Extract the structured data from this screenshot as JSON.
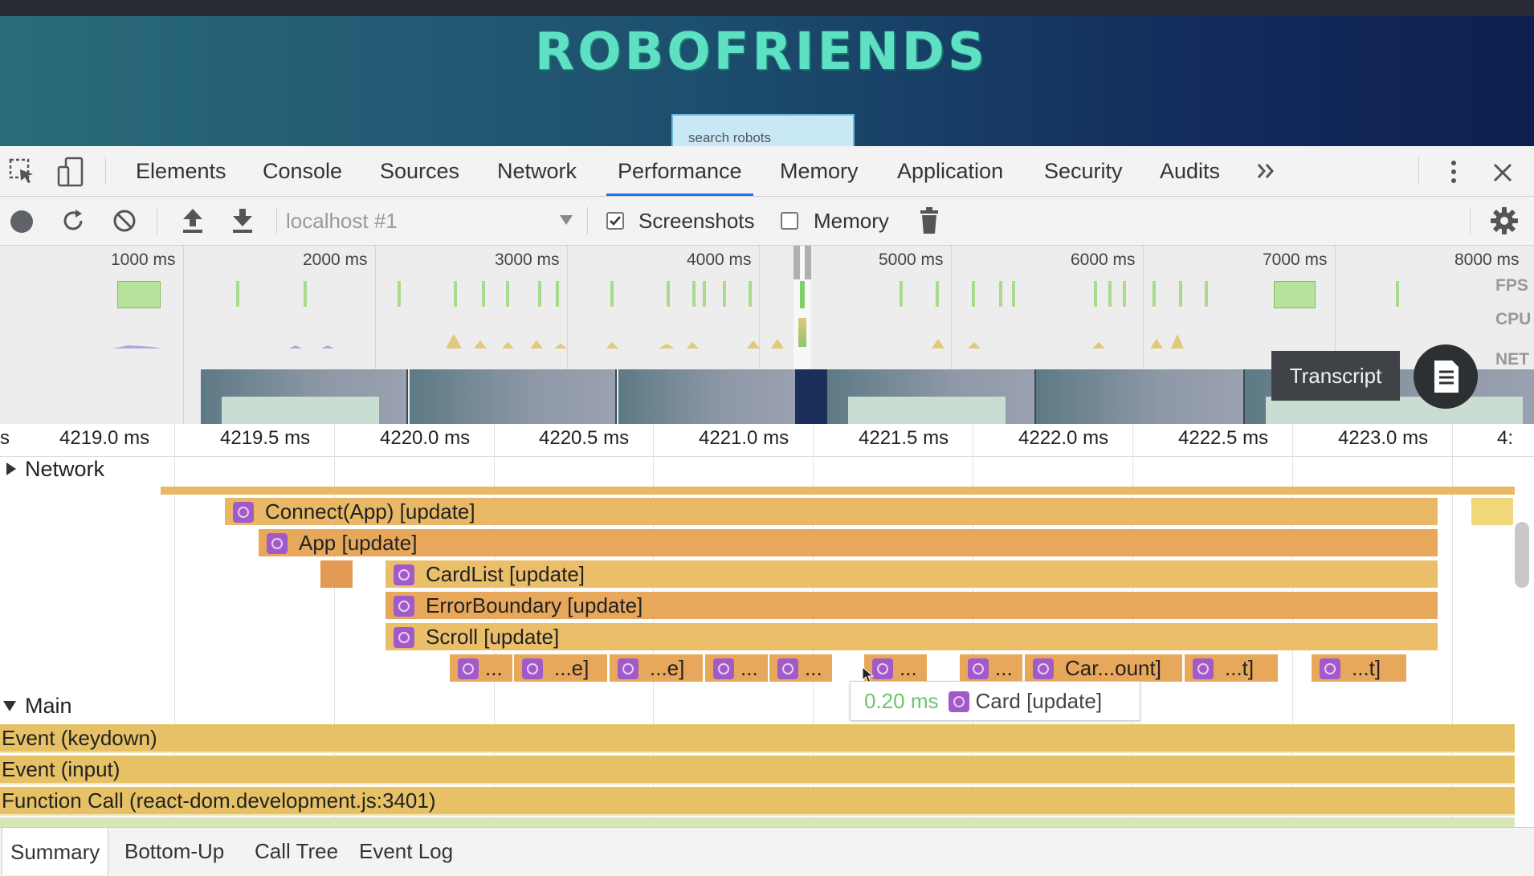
{
  "app": {
    "title": "ROBOFRIENDS",
    "search_placeholder": "search robots"
  },
  "devtools": {
    "tabs": [
      {
        "label": "Elements"
      },
      {
        "label": "Console"
      },
      {
        "label": "Sources"
      },
      {
        "label": "Network"
      },
      {
        "label": "Performance",
        "active": true
      },
      {
        "label": "Memory"
      },
      {
        "label": "Application"
      },
      {
        "label": "Security"
      },
      {
        "label": "Audits"
      }
    ],
    "more_tabs_icon": "double-chevron-right-icon",
    "close_icon": "close-icon"
  },
  "toolbar": {
    "profile_select": "localhost #1",
    "screenshots_label": "Screenshots",
    "screenshots_checked": true,
    "memory_label": "Memory",
    "memory_checked": false
  },
  "overview": {
    "ticks": [
      "1000 ms",
      "2000 ms",
      "3000 ms",
      "4000 ms",
      "5000 ms",
      "6000 ms",
      "7000 ms",
      "8000 ms"
    ],
    "track_labels": {
      "fps": "FPS",
      "cpu": "CPU",
      "net": "NET"
    }
  },
  "transcript": {
    "label": "Transcript",
    "icon": "document-icon"
  },
  "flame": {
    "ruler_ticks": [
      "4219.0 ms",
      "4219.5 ms",
      "4220.0 ms",
      "4220.5 ms",
      "4221.0 ms",
      "4221.5 ms",
      "4222.0 ms",
      "4222.5 ms",
      "4223.0 ms",
      "4:"
    ],
    "network_label": "Network",
    "timing_bars": [
      {
        "label": "Connect(App) [update]"
      },
      {
        "label": "App [update]"
      },
      {
        "label": "CardList [update]"
      },
      {
        "label": "ErrorBoundary [update]"
      },
      {
        "label": "Scroll [update]"
      }
    ],
    "card_bars": [
      "...",
      "...e]",
      "...e]",
      "...",
      "...",
      "...",
      "...",
      "Car...ount]",
      "...t]",
      "...t]"
    ],
    "tooltip": {
      "duration": "0.20 ms",
      "label": "Card [update]"
    },
    "main_label": "Main",
    "main_bars": [
      {
        "label": "Event (keydown)"
      },
      {
        "label": "Event (input)"
      },
      {
        "label": "Function Call (react-dom.development.js:3401)"
      }
    ]
  },
  "bottom_tabs": [
    {
      "label": "Summary",
      "active": true
    },
    {
      "label": "Bottom-Up"
    },
    {
      "label": "Call Tree"
    },
    {
      "label": "Event Log"
    }
  ],
  "colors": {
    "performance_tab_underline": "#1a73e8",
    "timing_bar": "#e9b866",
    "main_bar": "#e6c165",
    "react_icon": "#a35ac9",
    "tooltip_duration": "#6cc56c"
  }
}
